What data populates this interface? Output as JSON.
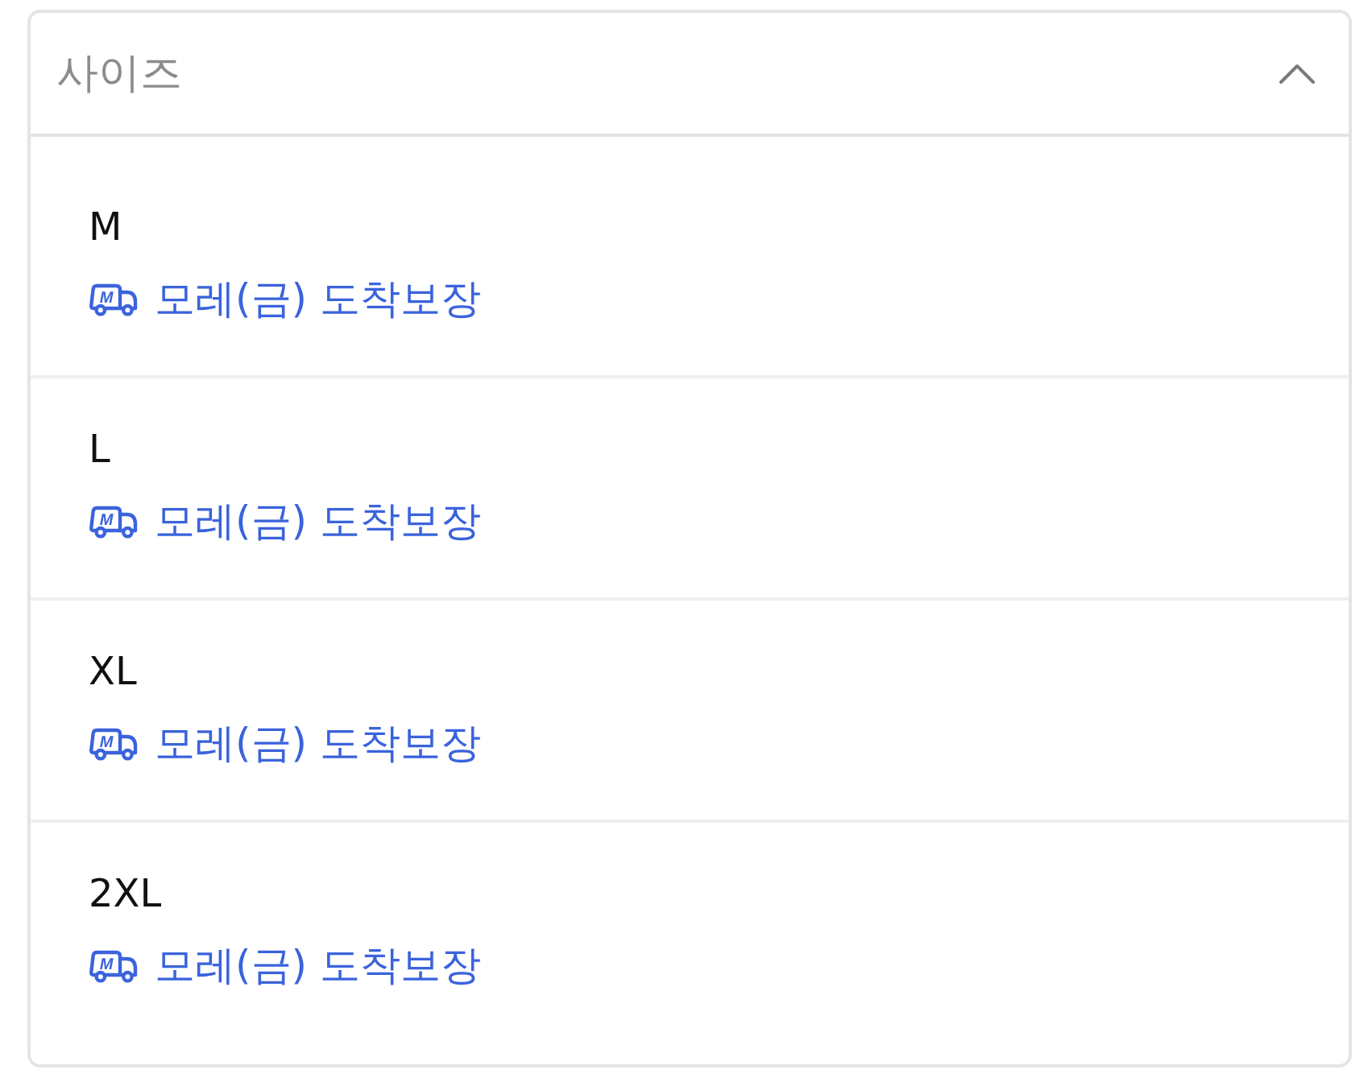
{
  "dropdown": {
    "label": "사이즈",
    "expanded": true
  },
  "options": [
    {
      "size": "M",
      "delivery": {
        "icon_letter": "M",
        "text": "모레(금) 도착보장"
      }
    },
    {
      "size": "L",
      "delivery": {
        "icon_letter": "M",
        "text": "모레(금) 도착보장"
      }
    },
    {
      "size": "XL",
      "delivery": {
        "icon_letter": "M",
        "text": "모레(금) 도착보장"
      }
    },
    {
      "size": "2XL",
      "delivery": {
        "icon_letter": "M",
        "text": "모레(금) 도착보장"
      }
    }
  ]
}
